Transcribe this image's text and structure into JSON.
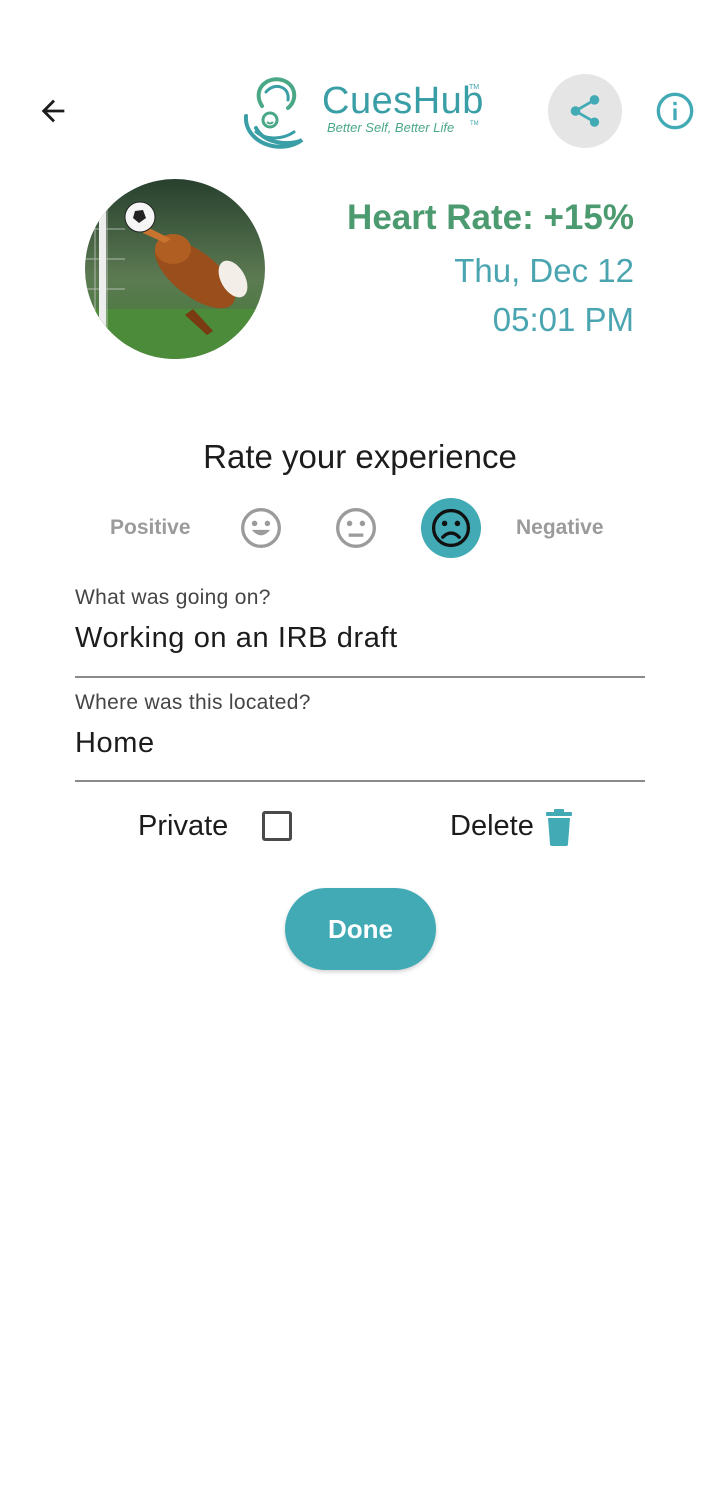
{
  "header": {
    "back_icon": "arrow-left-icon",
    "logo": {
      "title": "CuesHub",
      "title_tm": "TM",
      "tagline": "Better Self, Better Life",
      "tagline_tm": "TM"
    },
    "share_icon": "share-icon",
    "info_icon": "info-circle-icon"
  },
  "summary": {
    "heart_rate": "Heart Rate: +15%",
    "date": "Thu, Dec 12",
    "time": "05:01 PM"
  },
  "rating": {
    "title": "Rate your experience",
    "positive_label": "Positive",
    "negative_label": "Negative",
    "options": [
      {
        "icon": "smile-face-icon",
        "selected": false
      },
      {
        "icon": "neutral-face-icon",
        "selected": false
      },
      {
        "icon": "sad-face-icon",
        "selected": true
      }
    ]
  },
  "fields": {
    "activity": {
      "label": "What was going on?",
      "value": "Working on an IRB draft"
    },
    "location": {
      "label": "Where was this located?",
      "value": "Home"
    }
  },
  "options": {
    "private_label": "Private",
    "private_checked": false,
    "delete_label": "Delete",
    "delete_icon": "trash-icon"
  },
  "actions": {
    "done_label": "Done"
  },
  "colors": {
    "accent": "#41aab5",
    "heart_rate": "#4c9a6f",
    "date_time": "#4aa5b0",
    "inactive_label": "#9b9b9b"
  }
}
